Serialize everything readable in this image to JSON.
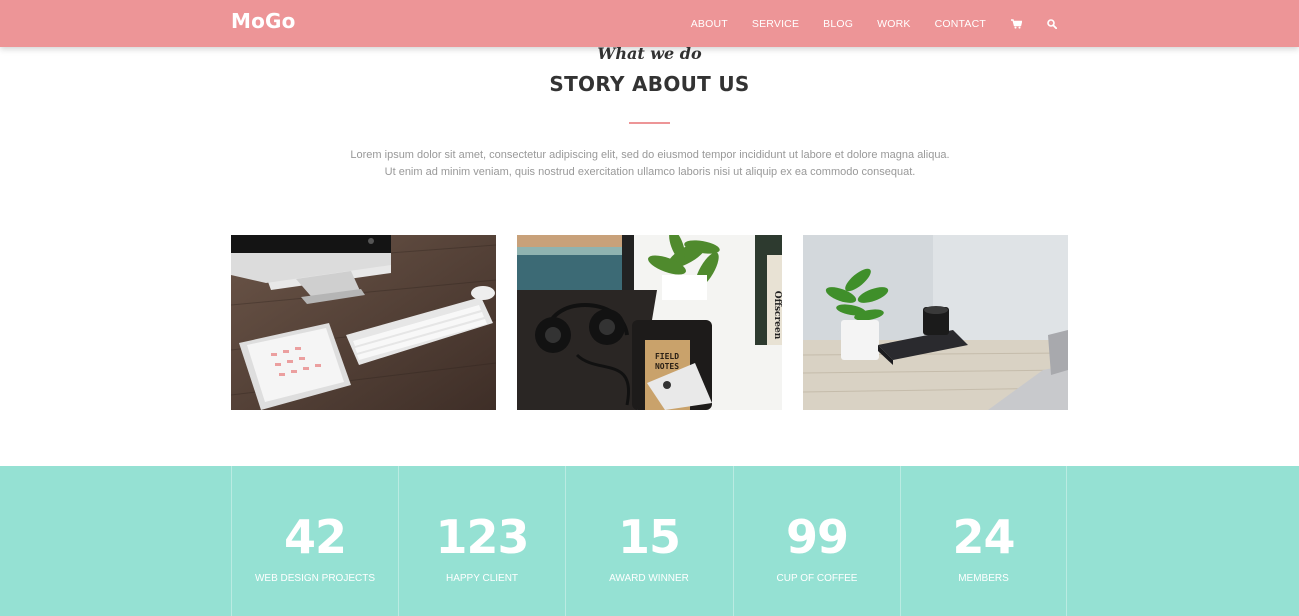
{
  "header": {
    "logo": "MoGo",
    "nav": [
      {
        "label": "ABOUT"
      },
      {
        "label": "SERVICE"
      },
      {
        "label": "BLOG"
      },
      {
        "label": "WORK"
      },
      {
        "label": "CONTACT"
      }
    ],
    "icons": [
      "cart-icon",
      "search-icon"
    ]
  },
  "story": {
    "subtitle": "What we do",
    "title": "STORY ABOUT US",
    "description_line1": "Lorem ipsum dolor sit amet, consectetur adipiscing elit, sed do eiusmod tempor incididunt ut labore et dolore magna aliqua.",
    "description_line2": "Ut enim ad minim veniam, quis nostrud exercitation ullamco laboris nisi ut aliquip ex ea commodo consequat."
  },
  "photos": [
    {
      "name": "desk-imac-keyboard-tablet"
    },
    {
      "name": "headphones-notebook-phone-plant",
      "notebook_text_1": "FIELD",
      "notebook_text_2": "NOTES",
      "book_text": "Offscreen"
    },
    {
      "name": "plant-camera-laptop"
    }
  ],
  "stats": [
    {
      "number": "42",
      "label": "WEB DESIGN PROJECTS"
    },
    {
      "number": "123",
      "label": "HAPPY CLIENT"
    },
    {
      "number": "15",
      "label": "AWARD WINNER"
    },
    {
      "number": "99",
      "label": "CUP OF COFFEE"
    },
    {
      "number": "24",
      "label": "MEMBERS"
    }
  ],
  "colors": {
    "header_bg": "#ed9597",
    "accent": "#ed9597",
    "stats_bg": "#95e1d3",
    "title_text": "#333333",
    "body_text": "#999999"
  }
}
